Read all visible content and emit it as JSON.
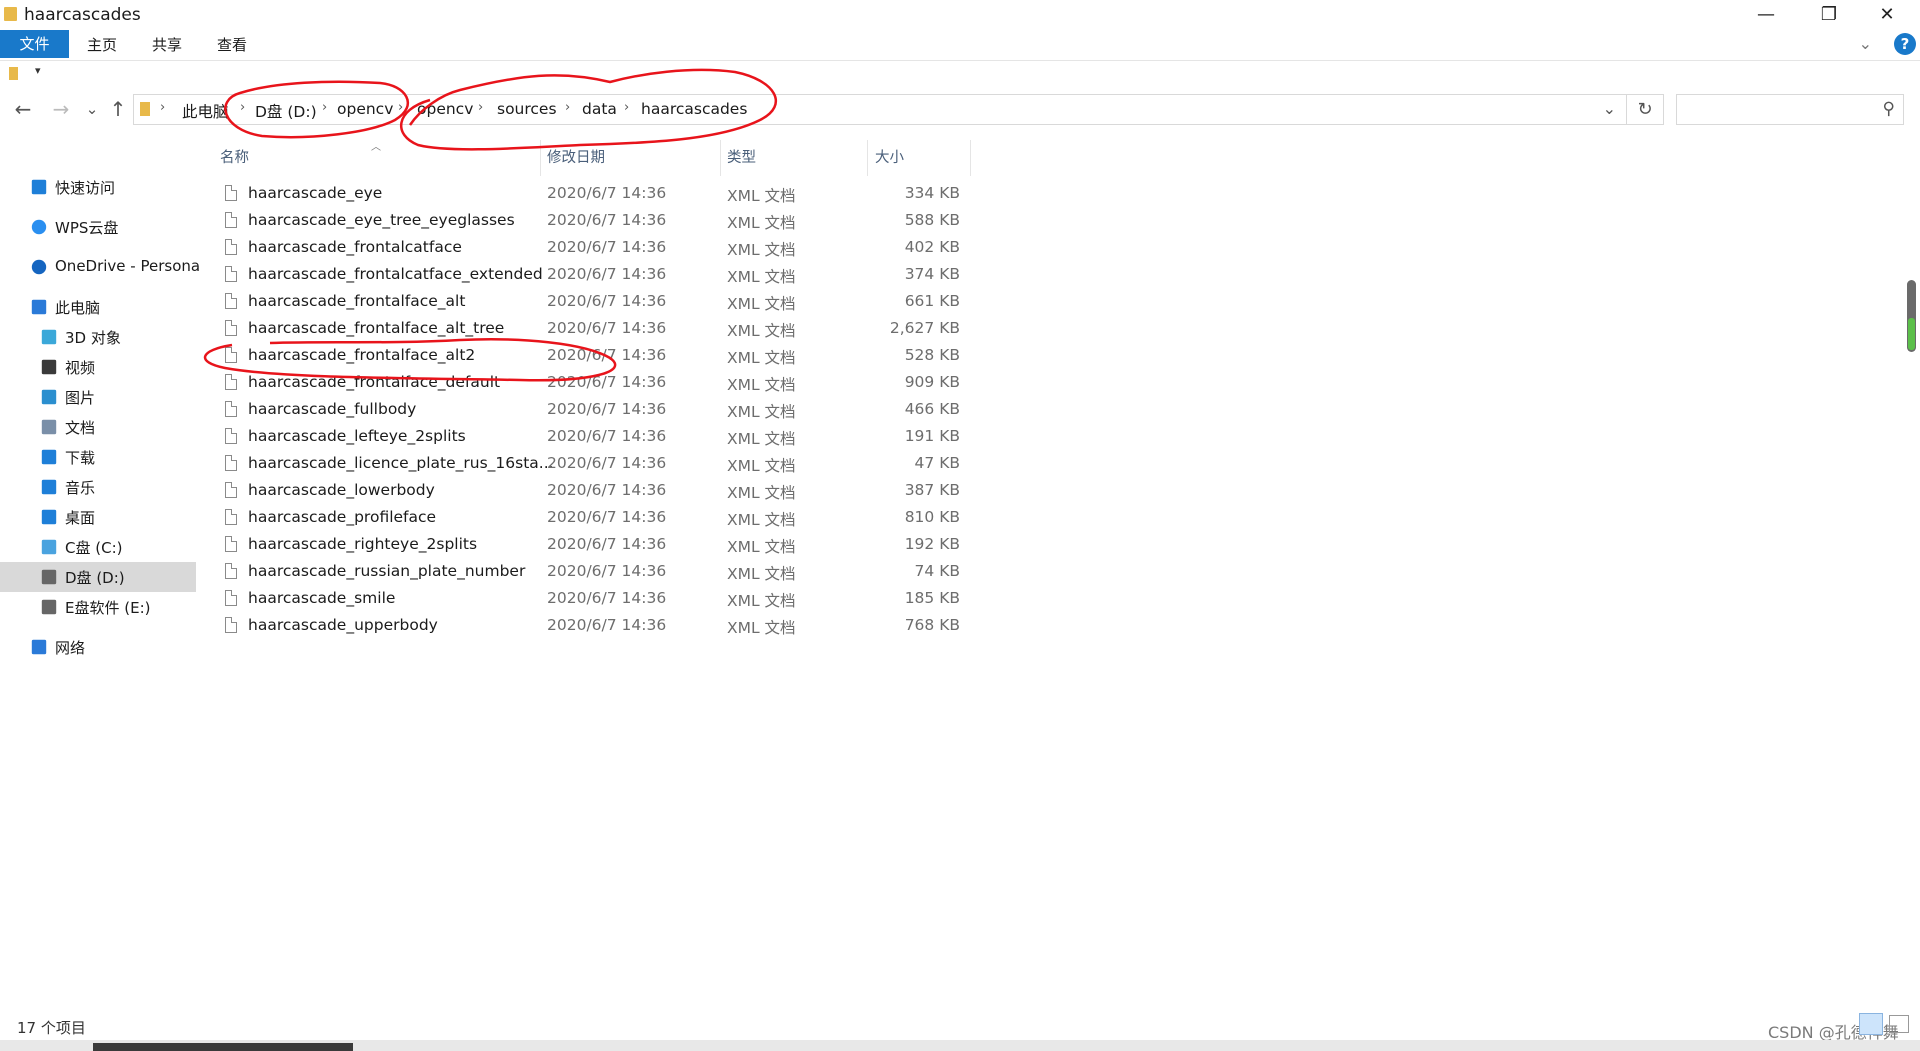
{
  "window": {
    "title": "haarcascades",
    "minimize_glyph": "—",
    "restore_glyph": "❐",
    "close_glyph": "✕"
  },
  "ribbon": {
    "tabs": [
      "文件",
      "主页",
      "共享",
      "查看"
    ],
    "help_glyph": "?"
  },
  "nav_buttons": {
    "back": "←",
    "forward": "→",
    "recent": "⌄",
    "up": "↑"
  },
  "address": {
    "crumbs": [
      "此电脑",
      "D盘 (D:)",
      "opencv",
      "opencv",
      "sources",
      "data",
      "haarcascades"
    ],
    "separator": "›",
    "refresh_glyph": "↻",
    "search_placeholder": ""
  },
  "nav_pane": [
    {
      "label": "快速访问",
      "icon": "star-icon",
      "color": "#1e7fd8"
    },
    {
      "label": "WPS云盘",
      "icon": "cloud-icon",
      "color": "#2a8ff0"
    },
    {
      "label": "OneDrive - Persona",
      "icon": "onedrive-icon",
      "color": "#1565c0"
    },
    {
      "label": "此电脑",
      "icon": "computer-icon",
      "color": "#2a7ad8"
    },
    {
      "label": "3D 对象",
      "icon": "cube-3d-icon",
      "color": "#3ba8d9"
    },
    {
      "label": "视频",
      "icon": "film-icon",
      "color": "#3a3a3a"
    },
    {
      "label": "图片",
      "icon": "picture-icon",
      "color": "#2b8fcf"
    },
    {
      "label": "文档",
      "icon": "document-icon",
      "color": "#7a8fa8"
    },
    {
      "label": "下载",
      "icon": "download-icon",
      "color": "#1e7fd8"
    },
    {
      "label": "音乐",
      "icon": "music-icon",
      "color": "#1e7fd8"
    },
    {
      "label": "桌面",
      "icon": "desktop-icon",
      "color": "#1e7fd8"
    },
    {
      "label": "C盘 (C:)",
      "icon": "drive-c-icon",
      "color": "#4aa3df"
    },
    {
      "label": "D盘 (D:)",
      "icon": "drive-d-icon",
      "color": "#666666"
    },
    {
      "label": "E盘软件 (E:)",
      "icon": "drive-e-icon",
      "color": "#666666"
    },
    {
      "label": "网络",
      "icon": "network-icon",
      "color": "#2a7ad8"
    }
  ],
  "columns": {
    "name": "名称",
    "date": "修改日期",
    "type": "类型",
    "size": "大小"
  },
  "files": [
    {
      "name": "haarcascade_eye",
      "date": "2020/6/7 14:36",
      "type": "XML 文档",
      "size": "334 KB"
    },
    {
      "name": "haarcascade_eye_tree_eyeglasses",
      "date": "2020/6/7 14:36",
      "type": "XML 文档",
      "size": "588 KB"
    },
    {
      "name": "haarcascade_frontalcatface",
      "date": "2020/6/7 14:36",
      "type": "XML 文档",
      "size": "402 KB"
    },
    {
      "name": "haarcascade_frontalcatface_extended",
      "date": "2020/6/7 14:36",
      "type": "XML 文档",
      "size": "374 KB"
    },
    {
      "name": "haarcascade_frontalface_alt",
      "date": "2020/6/7 14:36",
      "type": "XML 文档",
      "size": "661 KB"
    },
    {
      "name": "haarcascade_frontalface_alt_tree",
      "date": "2020/6/7 14:36",
      "type": "XML 文档",
      "size": "2,627 KB"
    },
    {
      "name": "haarcascade_frontalface_alt2",
      "date": "2020/6/7 14:36",
      "type": "XML 文档",
      "size": "528 KB"
    },
    {
      "name": "haarcascade_frontalface_default",
      "date": "2020/6/7 14:36",
      "type": "XML 文档",
      "size": "909 KB"
    },
    {
      "name": "haarcascade_fullbody",
      "date": "2020/6/7 14:36",
      "type": "XML 文档",
      "size": "466 KB"
    },
    {
      "name": "haarcascade_lefteye_2splits",
      "date": "2020/6/7 14:36",
      "type": "XML 文档",
      "size": "191 KB"
    },
    {
      "name": "haarcascade_licence_plate_rus_16sta...",
      "date": "2020/6/7 14:36",
      "type": "XML 文档",
      "size": "47 KB"
    },
    {
      "name": "haarcascade_lowerbody",
      "date": "2020/6/7 14:36",
      "type": "XML 文档",
      "size": "387 KB"
    },
    {
      "name": "haarcascade_profileface",
      "date": "2020/6/7 14:36",
      "type": "XML 文档",
      "size": "810 KB"
    },
    {
      "name": "haarcascade_righteye_2splits",
      "date": "2020/6/7 14:36",
      "type": "XML 文档",
      "size": "192 KB"
    },
    {
      "name": "haarcascade_russian_plate_number",
      "date": "2020/6/7 14:36",
      "type": "XML 文档",
      "size": "74 KB"
    },
    {
      "name": "haarcascade_smile",
      "date": "2020/6/7 14:36",
      "type": "XML 文档",
      "size": "185 KB"
    },
    {
      "name": "haarcascade_upperbody",
      "date": "2020/6/7 14:36",
      "type": "XML 文档",
      "size": "768 KB"
    }
  ],
  "status": {
    "item_count": "17 个项目"
  },
  "watermark": "CSDN @孔德祥舞",
  "colors": {
    "accent": "#1979ca",
    "annotation": "#e8141b",
    "selection": "#d9d9d9"
  }
}
